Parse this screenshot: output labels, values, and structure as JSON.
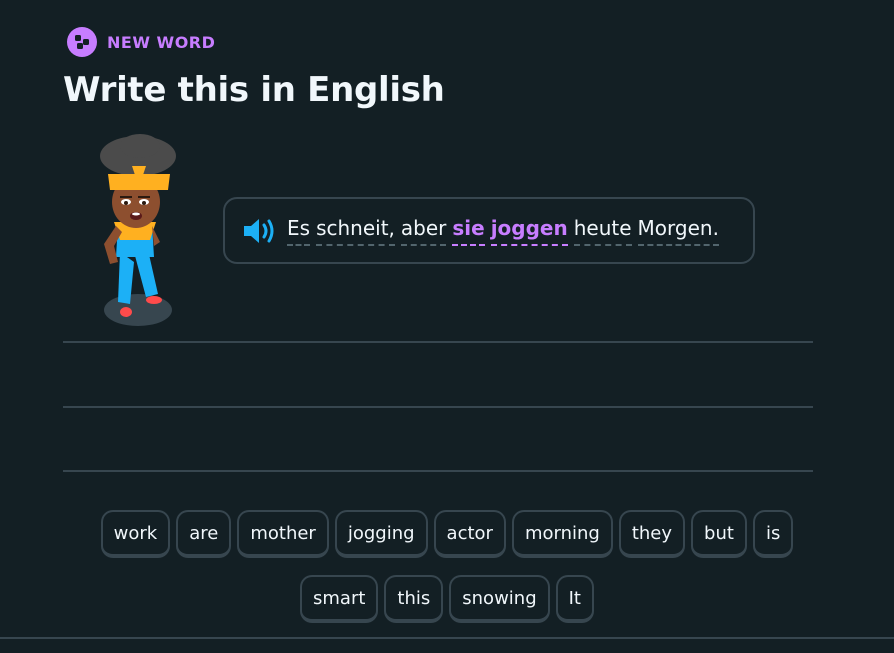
{
  "header": {
    "badge_label": "NEW WORD",
    "badge_icon": "puzzle-icon",
    "title": "Write this in English"
  },
  "prompt": {
    "speaker_icon": "speaker-icon",
    "words": [
      {
        "text": "Es",
        "highlight": false
      },
      {
        "text": "schneit,",
        "highlight": false
      },
      {
        "text": "aber",
        "highlight": false
      },
      {
        "text": "sie",
        "highlight": true
      },
      {
        "text": "joggen",
        "highlight": true
      },
      {
        "text": "heute",
        "highlight": false
      },
      {
        "text": "Morgen.",
        "highlight": false
      }
    ]
  },
  "word_bank": {
    "row1": [
      "work",
      "are",
      "mother",
      "jogging",
      "actor",
      "morning",
      "they",
      "but",
      "is"
    ],
    "row2": [
      "smart",
      "this",
      "snowing",
      "It"
    ]
  },
  "colors": {
    "background": "#131f24",
    "accent": "#c77dff",
    "border": "#37464f",
    "text": "#f1f7fb",
    "speaker": "#1cb0f6"
  }
}
